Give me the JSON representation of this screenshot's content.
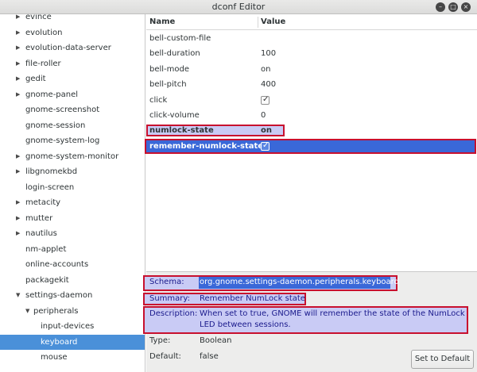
{
  "window": {
    "title": "dconf Editor",
    "minimize_glyph": "–",
    "maximize_glyph": "□",
    "close_glyph": "×"
  },
  "sidebar": {
    "items": [
      {
        "label": "evince",
        "indent": 0,
        "arrow": "right"
      },
      {
        "label": "evolution",
        "indent": 0,
        "arrow": "right"
      },
      {
        "label": "evolution-data-server",
        "indent": 0,
        "arrow": "right"
      },
      {
        "label": "file-roller",
        "indent": 0,
        "arrow": "right"
      },
      {
        "label": "gedit",
        "indent": 0,
        "arrow": "right"
      },
      {
        "label": "gnome-panel",
        "indent": 0,
        "arrow": "right"
      },
      {
        "label": "gnome-screenshot",
        "indent": 0,
        "arrow": "none"
      },
      {
        "label": "gnome-session",
        "indent": 0,
        "arrow": "none"
      },
      {
        "label": "gnome-system-log",
        "indent": 0,
        "arrow": "none"
      },
      {
        "label": "gnome-system-monitor",
        "indent": 0,
        "arrow": "right"
      },
      {
        "label": "libgnomekbd",
        "indent": 0,
        "arrow": "right"
      },
      {
        "label": "login-screen",
        "indent": 0,
        "arrow": "none"
      },
      {
        "label": "metacity",
        "indent": 0,
        "arrow": "right"
      },
      {
        "label": "mutter",
        "indent": 0,
        "arrow": "right"
      },
      {
        "label": "nautilus",
        "indent": 0,
        "arrow": "right"
      },
      {
        "label": "nm-applet",
        "indent": 0,
        "arrow": "none"
      },
      {
        "label": "online-accounts",
        "indent": 0,
        "arrow": "none"
      },
      {
        "label": "packagekit",
        "indent": 0,
        "arrow": "none"
      },
      {
        "label": "settings-daemon",
        "indent": 0,
        "arrow": "down"
      },
      {
        "label": "peripherals",
        "indent": 1,
        "arrow": "down"
      },
      {
        "label": "input-devices",
        "indent": 2,
        "arrow": "none"
      },
      {
        "label": "keyboard",
        "indent": 2,
        "arrow": "none",
        "selected": true
      },
      {
        "label": "mouse",
        "indent": 2,
        "arrow": "none"
      }
    ]
  },
  "keys": {
    "header_name": "Name",
    "header_value": "Value",
    "rows": [
      {
        "name": "bell-custom-file",
        "value": "",
        "type": "text"
      },
      {
        "name": "bell-duration",
        "value": "100",
        "type": "text"
      },
      {
        "name": "bell-mode",
        "value": "on",
        "type": "text"
      },
      {
        "name": "bell-pitch",
        "value": "400",
        "type": "text"
      },
      {
        "name": "click",
        "value": "",
        "type": "checkbox",
        "checked": true
      },
      {
        "name": "click-volume",
        "value": "0",
        "type": "text"
      },
      {
        "name": "numlock-state",
        "value": "on",
        "type": "text",
        "bold": true
      },
      {
        "name": "remember-numlock-state",
        "value": "",
        "type": "checkbox",
        "checked": true,
        "bold": true,
        "selected": true
      }
    ]
  },
  "info": {
    "schema_label": "Schema:",
    "schema_value": "org.gnome.settings-daemon.peripherals.keyboard",
    "summary_label": "Summary:",
    "summary_value": "Remember NumLock state",
    "description_label": "Description:",
    "description_line1": "When set to true, GNOME will remember the state of the NumLock",
    "description_line2": "LED between sessions.",
    "type_label": "Type:",
    "type_value": "Boolean",
    "default_label": "Default:",
    "default_value": "false",
    "set_default_label": "Set to Default"
  },
  "colors": {
    "selection": "#4a90d9",
    "highlight_fill": "#c9cbf5",
    "annotation_border": "#c8102e",
    "selected_row": "#3a68d8"
  }
}
